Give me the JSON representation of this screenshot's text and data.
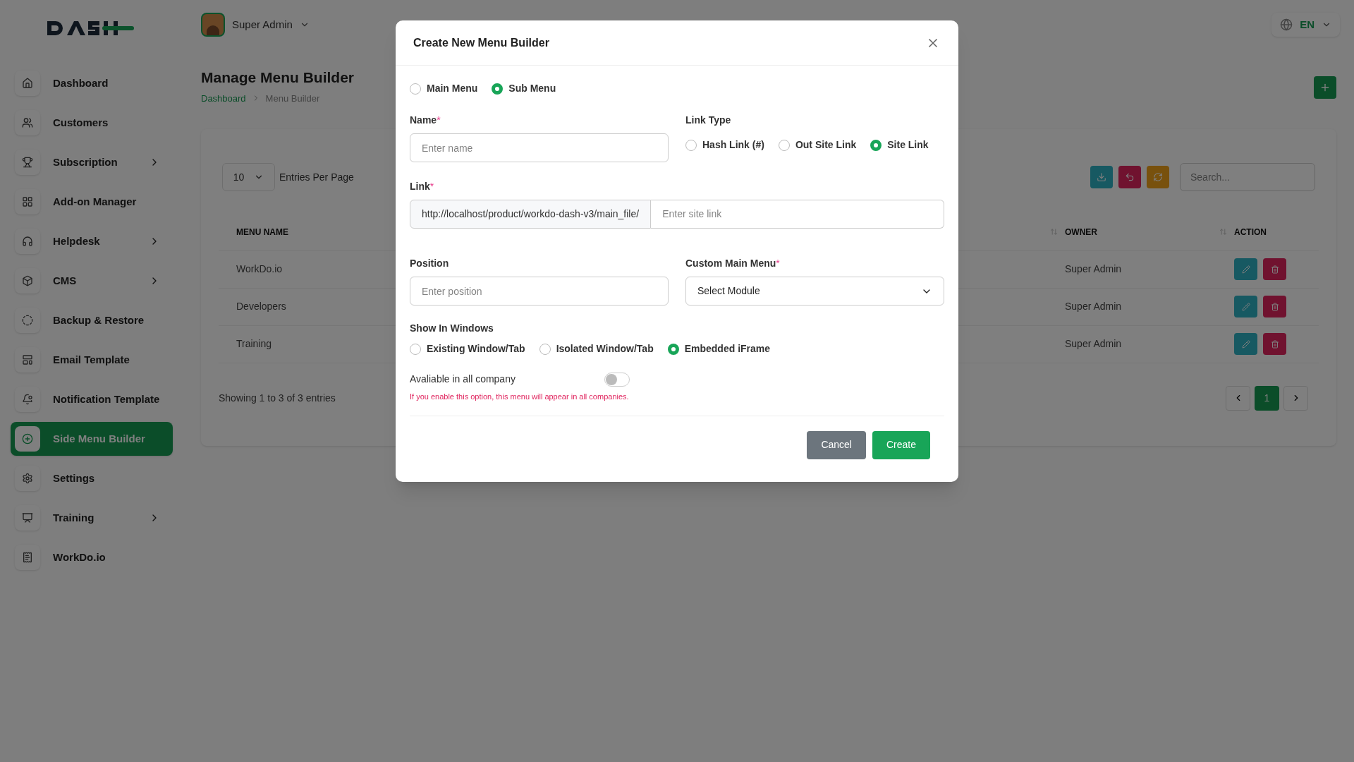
{
  "header": {
    "user": "Super Admin",
    "language": "EN"
  },
  "sidebar": {
    "items": [
      {
        "label": "Dashboard",
        "kind": "home",
        "selected": false,
        "expandable": false
      },
      {
        "label": "Customers",
        "kind": "users",
        "selected": false,
        "expandable": false
      },
      {
        "label": "Subscription",
        "kind": "trophy",
        "selected": false,
        "expandable": true
      },
      {
        "label": "Add-on Manager",
        "kind": "grid",
        "selected": false,
        "expandable": false
      },
      {
        "label": "Helpdesk",
        "kind": "headphones",
        "selected": false,
        "expandable": true
      },
      {
        "label": "CMS",
        "kind": "box",
        "selected": false,
        "expandable": true
      },
      {
        "label": "Backup & Restore",
        "kind": "backup",
        "selected": false,
        "expandable": false
      },
      {
        "label": "Email Template",
        "kind": "template",
        "selected": false,
        "expandable": false
      },
      {
        "label": "Notification Template",
        "kind": "notification",
        "selected": false,
        "expandable": false
      },
      {
        "label": "Side Menu Builder",
        "kind": "plus",
        "selected": true,
        "expandable": false
      },
      {
        "label": "Settings",
        "kind": "settings",
        "selected": false,
        "expandable": false
      },
      {
        "label": "Training",
        "kind": "training",
        "selected": false,
        "expandable": true
      },
      {
        "label": "WorkDo.io",
        "kind": "receipt",
        "selected": false,
        "expandable": false
      }
    ]
  },
  "page": {
    "title": "Manage Menu Builder",
    "breadcrumb": [
      "Dashboard",
      "Menu Builder"
    ],
    "entries_per_page": "10",
    "entries_label": "Entries Per Page",
    "search": {
      "placeholder": "Search..."
    },
    "table": {
      "columns": [
        {
          "label": "MENU NAME"
        },
        {
          "sortable": true
        },
        {
          "label": "OWNER",
          "sortable": true
        },
        {
          "label": "ACTION"
        }
      ],
      "rows": [
        {
          "menu_name": "WorkDo.io",
          "owner": "Super Admin"
        },
        {
          "menu_name": "Developers",
          "owner": "Super Admin"
        },
        {
          "menu_name": "Training",
          "owner": "Super Admin"
        }
      ]
    },
    "footer": "Showing 1 to 3 of 3 entries",
    "pagination": [
      {
        "label": "1",
        "selected": true
      }
    ]
  },
  "modal": {
    "title": "Create New Menu Builder",
    "required_mark": "*",
    "menu_type": [
      {
        "label": "Main Menu",
        "selected": false
      },
      {
        "label": "Sub Menu",
        "selected": true
      }
    ],
    "name": {
      "label": "Name",
      "required": true,
      "placeholder": "Enter name"
    },
    "link_type": {
      "label": "Link Type",
      "options": [
        {
          "label": "Hash Link (#)",
          "selected": false
        },
        {
          "label": "Out Site Link",
          "selected": false
        },
        {
          "label": "Site Link",
          "selected": true
        }
      ]
    },
    "link": {
      "label": "Link",
      "required": true,
      "prefix": "http://localhost/product/workdo-dash-v3/main_file/",
      "placeholder": "Enter site link"
    },
    "position": {
      "label": "Position",
      "placeholder": "Enter position"
    },
    "custom_main_menu": {
      "label": "Custom Main Menu",
      "required": true,
      "value": "Select Module"
    },
    "show_in_windows": {
      "label": "Show In Windows",
      "options": [
        {
          "label": "Existing Window/Tab",
          "selected": false
        },
        {
          "label": "Isolated Window/Tab",
          "selected": false
        },
        {
          "label": "Embedded iFrame",
          "selected": true
        }
      ]
    },
    "available": {
      "label": "Avaliable in all company",
      "on": false,
      "hint": "If you enable this option, this menu will appear in all companies."
    },
    "buttons": [
      {
        "label": "Cancel",
        "kind": "cancel"
      },
      {
        "label": "Create",
        "kind": "primary"
      }
    ]
  }
}
